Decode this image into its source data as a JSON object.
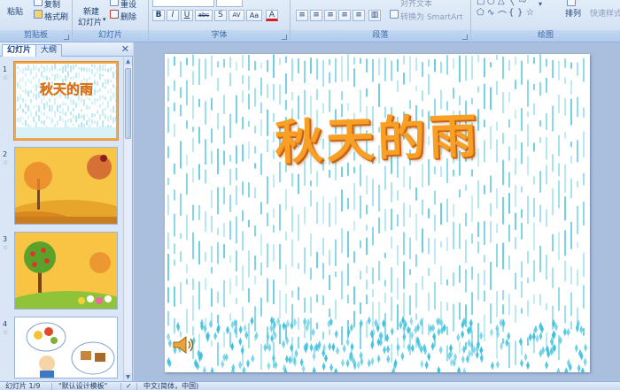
{
  "ribbon": {
    "clipboard": {
      "paste_label": "粘贴",
      "copy_label": "复制",
      "format_painter_label": "格式刷",
      "group_label": "剪贴板"
    },
    "slides": {
      "new_slide_label_1": "新建",
      "new_slide_label_2": "幻灯片",
      "reset_label": "重设",
      "delete_label": "删除",
      "group_label": "幻灯片"
    },
    "font": {
      "bold": "B",
      "italic": "I",
      "underline": "U",
      "strike": "abc",
      "shadow": "S",
      "spacing": "AV",
      "case": "Aa",
      "color": "A",
      "group_label": "字体"
    },
    "paragraph": {
      "align_text_label": "对齐文本",
      "smartart_label": "转换为 SmartArt",
      "group_label": "段落"
    },
    "drawing": {
      "arrange_label": "排列",
      "quick_styles_label": "快速样式",
      "group_label": "绘图"
    }
  },
  "left_pane": {
    "tabs": [
      "幻灯片",
      "大纲"
    ],
    "active_tab": "幻灯片",
    "close_glyph": "✕",
    "slides": [
      {
        "number": "1",
        "star": "☆",
        "thumb_title": "秋天的雨",
        "selected": true
      },
      {
        "number": "2",
        "star": "☆",
        "selected": false
      },
      {
        "number": "3",
        "star": "☆",
        "selected": false
      },
      {
        "number": "4",
        "star": "☆",
        "selected": false
      }
    ]
  },
  "slide": {
    "title": "秋天的雨",
    "speaker_icon": "speaker-icon"
  },
  "status_bar": {
    "slide_count": "幻灯片 1/9",
    "theme": "\"默认设计模板\"",
    "language": "中文(简体，中国)"
  },
  "colors": {
    "title_orange": "#f7a025",
    "rain_cyan": "#1fb6d3",
    "selected_border": "#f5a94a"
  }
}
